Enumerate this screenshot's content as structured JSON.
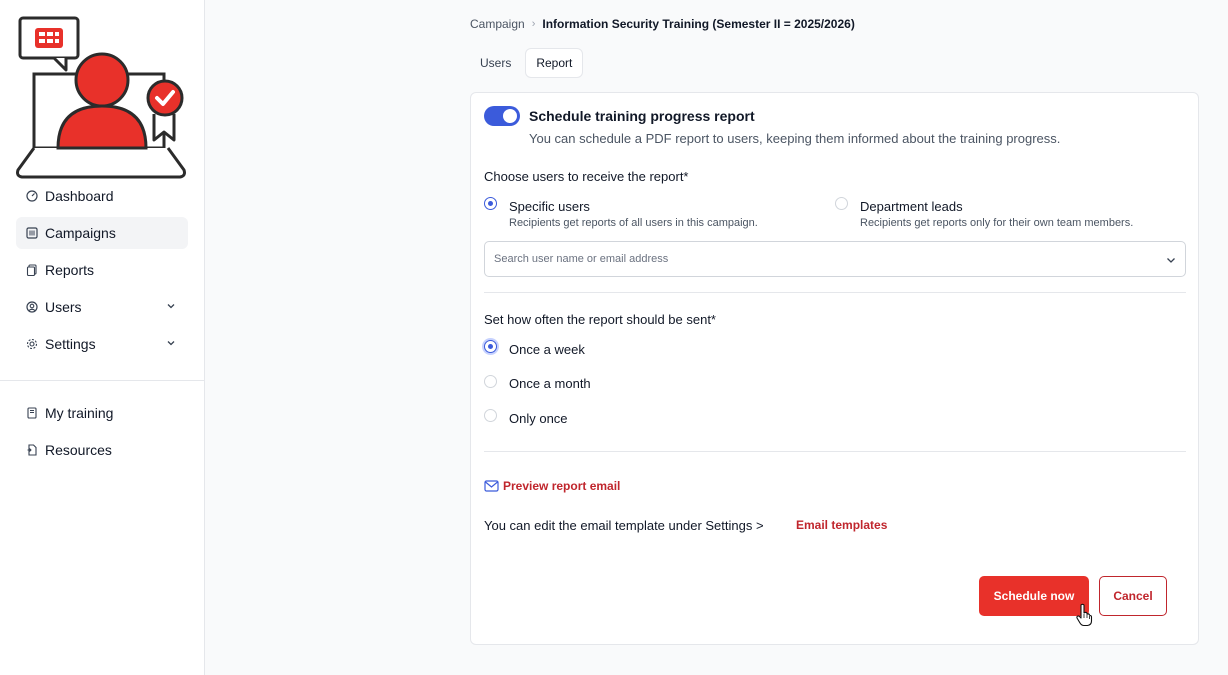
{
  "sidebar": {
    "items": [
      {
        "label": "Dashboard",
        "icon": "gauge-icon"
      },
      {
        "label": "Campaigns",
        "icon": "campaign-icon"
      },
      {
        "label": "Reports",
        "icon": "reports-icon"
      },
      {
        "label": "Users",
        "icon": "user-circle-icon"
      },
      {
        "label": "Settings",
        "icon": "gear-icon"
      }
    ],
    "secondary_items": [
      {
        "label": "My training",
        "icon": "book-icon"
      },
      {
        "label": "Resources",
        "icon": "document-icon"
      }
    ]
  },
  "breadcrumb": {
    "parent": "Campaign",
    "current": "Information Security Training (Semester II = 2025/2026)"
  },
  "tabs": [
    {
      "label": "Users",
      "active": false
    },
    {
      "label": "Report",
      "active": true
    }
  ],
  "schedule": {
    "enabled": true,
    "title": "Schedule training progress report",
    "description": "You can schedule a PDF report to users, keeping them informed about the training progress."
  },
  "recipients": {
    "label": "Choose users to receive the report*",
    "options": [
      {
        "label": "Specific users",
        "sublabel": "Recipients get reports of all users in this campaign.",
        "checked": true
      },
      {
        "label": "Department leads",
        "sublabel": "Recipients get reports only for their own team members.",
        "checked": false
      }
    ],
    "search_placeholder": "Search user name or email address"
  },
  "frequency": {
    "label": "Set how often the report should be sent*",
    "options": [
      {
        "label": "Once a week",
        "checked": true
      },
      {
        "label": "Once a month",
        "checked": false
      },
      {
        "label": "Only once",
        "checked": false
      }
    ]
  },
  "preview_link": "Preview report email",
  "edit_template": {
    "text": "You can edit the email template under Settings >",
    "link": "Email templates"
  },
  "buttons": {
    "schedule": "Schedule now",
    "cancel": "Cancel"
  },
  "colors": {
    "brand_red": "#e8312a",
    "link_red": "#c0262d",
    "accent_blue": "#3b5bdb"
  }
}
